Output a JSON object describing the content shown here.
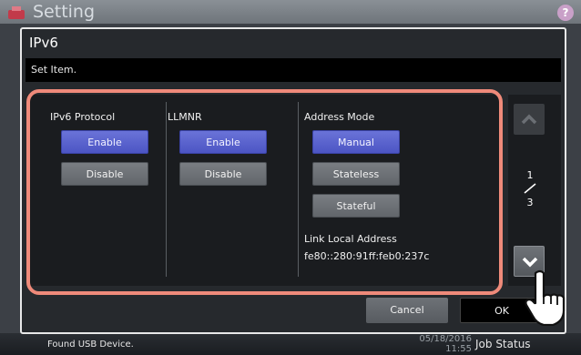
{
  "app": {
    "title": "Setting"
  },
  "dialog": {
    "title": "IPv6",
    "subtitle": "Set Item.",
    "columns": [
      {
        "label": "IPv6 Protocol",
        "enable": "Enable",
        "disable": "Disable"
      },
      {
        "label": "LLMNR",
        "enable": "Enable",
        "disable": "Disable"
      }
    ],
    "address_mode": {
      "label": "Address Mode",
      "options": [
        "Manual",
        "Stateless",
        "Stateful"
      ],
      "selected": "Manual"
    },
    "link_local": {
      "label": "Link Local Address",
      "value": "fe80::280:91ff:feb0:237c"
    },
    "pager": {
      "current": "1",
      "total": "3"
    },
    "cancel_label": "Cancel",
    "ok_label": "OK"
  },
  "status": {
    "message": "Found USB Device.",
    "date": "05/18/2016",
    "time": "11:55",
    "job_status": "Job Status"
  },
  "colors": {
    "selected": "#5059c8",
    "highlight": "#ef8a7a"
  }
}
